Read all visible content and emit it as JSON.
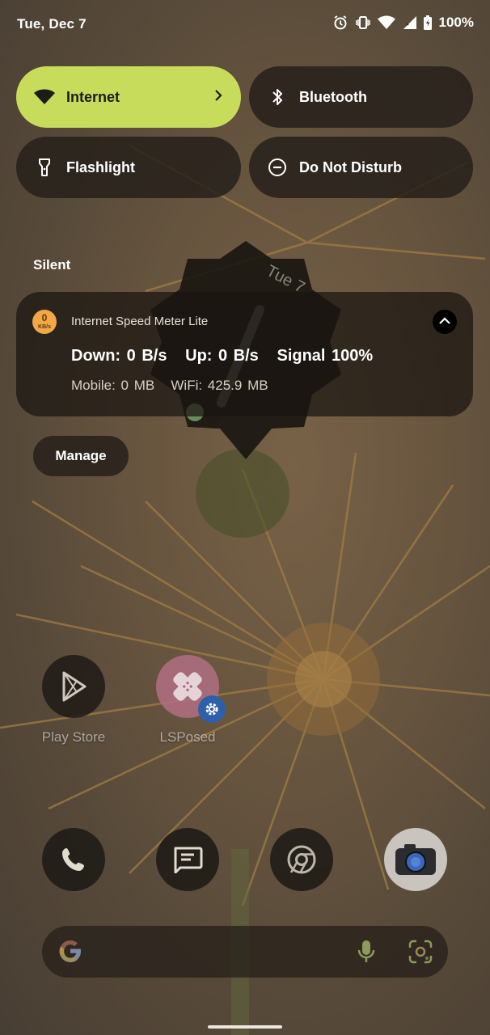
{
  "status_bar": {
    "date": "Tue, Dec 7",
    "battery": "100%",
    "icons": [
      "alarm-icon",
      "vibrate-icon",
      "wifi-icon",
      "signal-icon",
      "battery-icon"
    ]
  },
  "quick_settings": {
    "tiles": [
      {
        "label": "Internet",
        "icon": "wifi-icon",
        "active": true
      },
      {
        "label": "Bluetooth",
        "icon": "bluetooth-icon",
        "active": false
      },
      {
        "label": "Flashlight",
        "icon": "flashlight-icon",
        "active": false
      },
      {
        "label": "Do Not Disturb",
        "icon": "do-not-disturb-icon",
        "active": false
      }
    ],
    "active_color": "#c8dc5c"
  },
  "notifications": {
    "section_label": "Silent",
    "card": {
      "app_icon_value": "0",
      "app_icon_unit": "KB/s",
      "app_name": "Internet Speed Meter Lite",
      "line1": "Down: 0 B/s   Up: 0 B/s   Signal 100%",
      "line2": "Mobile: 0 MB   WiFi: 425.9 MB"
    },
    "manage_label": "Manage"
  },
  "clock_widget": {
    "date_text": "Tue 7"
  },
  "home_apps": [
    {
      "label": "Play Store",
      "icon": "play-store-icon"
    },
    {
      "label": "LSPosed",
      "icon": "lsposed-icon"
    }
  ],
  "dock": [
    "phone-icon",
    "messages-icon",
    "chrome-icon",
    "camera-icon"
  ],
  "search_bar": {
    "icons": [
      "google-g-icon",
      "mic-icon",
      "lens-icon"
    ]
  }
}
